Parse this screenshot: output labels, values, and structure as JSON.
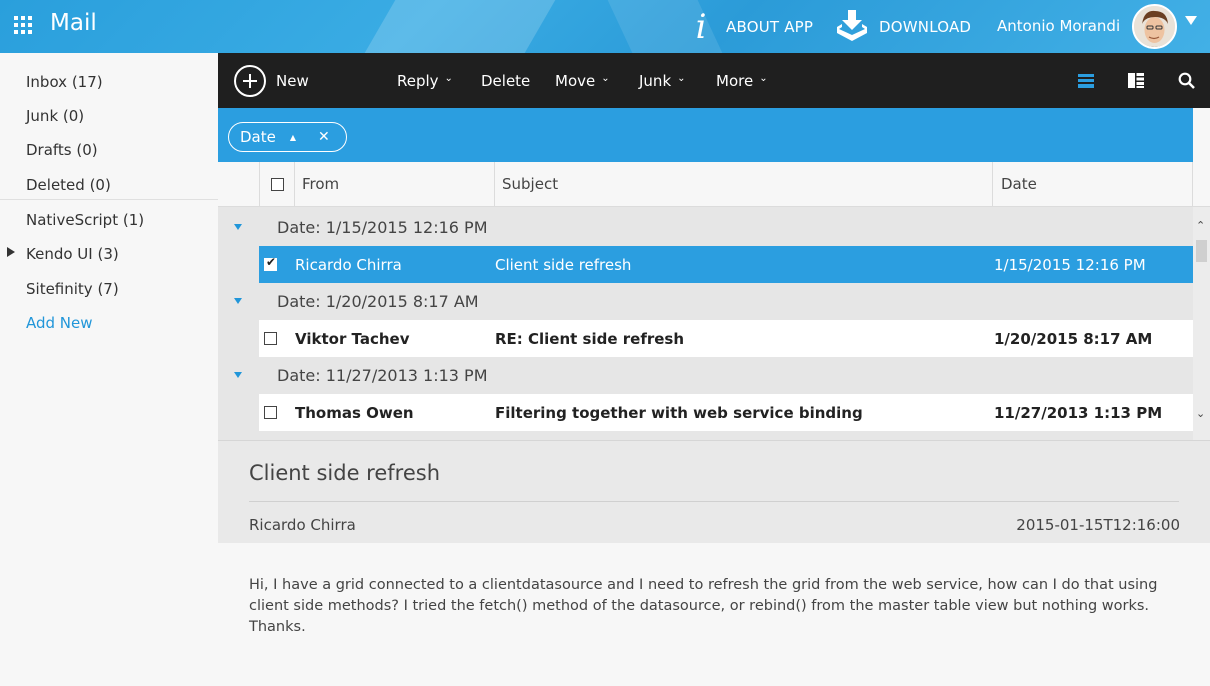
{
  "header": {
    "app_title": "Mail",
    "about_label": "ABOUT APP",
    "download_label": "DOWNLOAD",
    "user_name": "Antonio Morandi",
    "accent_color": "#2b9ee0"
  },
  "sidebar": {
    "items": [
      {
        "label": "Inbox (17)"
      },
      {
        "label": "Junk (0)"
      },
      {
        "label": "Drafts (0)"
      },
      {
        "label": "Deleted (0)"
      },
      {
        "label": "NativeScript (1)"
      },
      {
        "label": "Kendo UI (3)"
      },
      {
        "label": "Sitefinity (7)"
      }
    ],
    "add_new": "Add New"
  },
  "toolbar": {
    "new_label": "New",
    "reply_label": "Reply",
    "delete_label": "Delete",
    "move_label": "Move",
    "junk_label": "Junk",
    "more_label": "More"
  },
  "filter": {
    "chip_label": "Date"
  },
  "grid": {
    "columns": [
      "From",
      "Subject",
      "Date"
    ],
    "groups": [
      {
        "label": "Date: 1/15/2015 12:16 PM",
        "row": {
          "from": "Ricardo Chirra",
          "subject": "Client side refresh",
          "date": "1/15/2015 12:16 PM",
          "selected": true,
          "unread": false,
          "checked": true
        }
      },
      {
        "label": "Date: 1/20/2015 8:17 AM",
        "row": {
          "from": "Viktor Tachev",
          "subject": "RE: Client side refresh",
          "date": "1/20/2015 8:17 AM",
          "selected": false,
          "unread": true,
          "checked": false
        }
      },
      {
        "label": "Date: 11/27/2013 1:13 PM",
        "row": {
          "from": "Thomas Owen",
          "subject": "Filtering together with web service binding",
          "date": "11/27/2013 1:13 PM",
          "selected": false,
          "unread": true,
          "checked": false
        }
      }
    ]
  },
  "reading": {
    "subject": "Client side refresh",
    "from": "Ricardo Chirra",
    "date": "2015-01-15T12:16:00",
    "body": "Hi, I have a grid connected to a clientdatasource and I need to refresh the grid from the web service, how can I do that using client side methods? I tried the fetch() method of the datasource, or rebind() from the master table view but nothing works. Thanks."
  }
}
